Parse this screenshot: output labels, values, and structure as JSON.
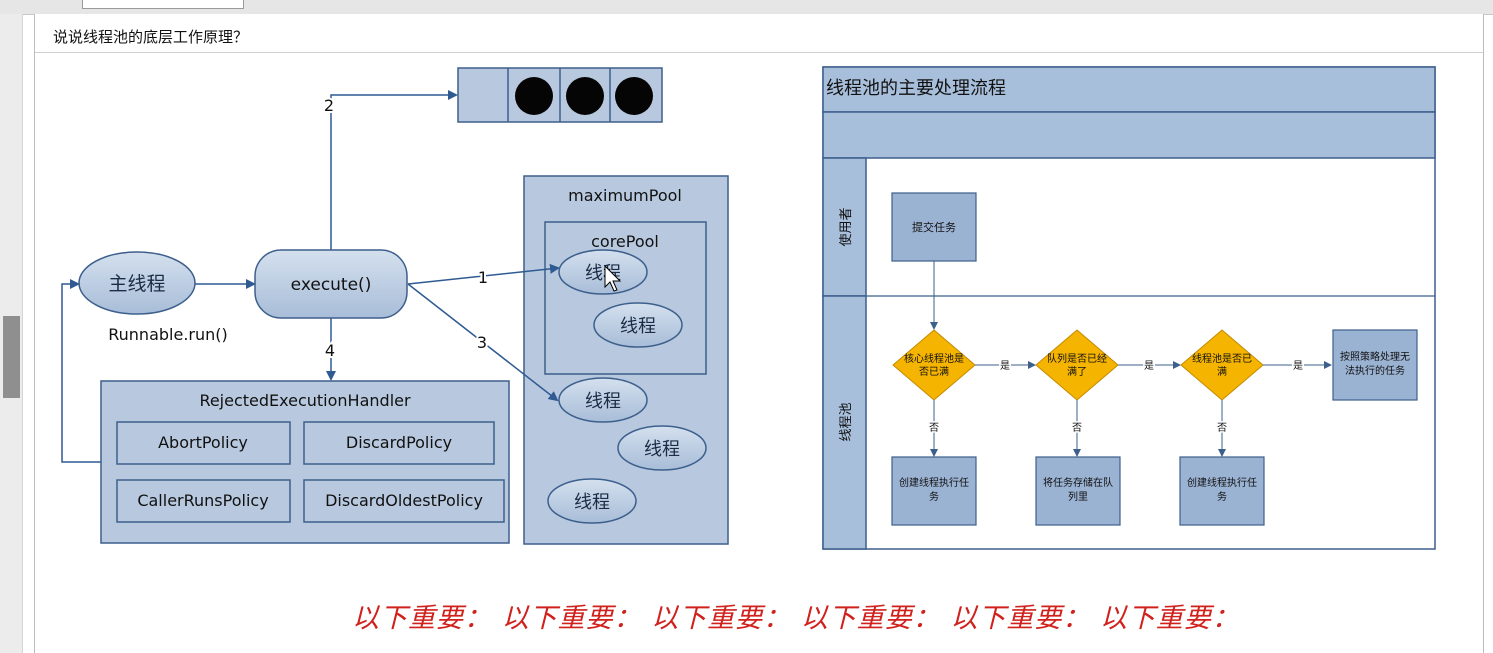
{
  "question": "说说线程池的底层工作原理？",
  "left_diagram": {
    "main_thread": "主线程",
    "runnable": "Runnable.run()",
    "execute": "execute()",
    "arrow_labels": {
      "one": "1",
      "two": "2",
      "three": "3",
      "four": "4"
    },
    "maximum_pool": "maximumPool",
    "core_pool": "corePool",
    "thread": "线程",
    "handler": "RejectedExecutionHandler",
    "policies": {
      "abort": "AbortPolicy",
      "discard": "DiscardPolicy",
      "caller_runs": "CallerRunsPolicy",
      "discard_oldest": "DiscardOldestPolicy"
    }
  },
  "flowchart": {
    "title": "线程池的主要处理流程",
    "lane_user": "使用者",
    "lane_pool": "线程池",
    "submit": "提交任务",
    "decision1": [
      "核心线程池是",
      "否已满"
    ],
    "decision2": [
      "队列是否已经",
      "满了"
    ],
    "decision3": [
      "线程池是否已",
      "满"
    ],
    "yes": "是",
    "no": "否",
    "result_reject": [
      "按照策略处理无",
      "法执行的任务"
    ],
    "result1": [
      "创建线程执行任",
      "务"
    ],
    "result2": [
      "将任务存储在队",
      "列里"
    ],
    "result3": [
      "创建线程执行任",
      "务"
    ]
  },
  "important_note": "以下重要： 以下重要： 以下重要： 以下重要： 以下重要： 以下重要：",
  "colors": {
    "box_fill": "#b8c9df",
    "box_stroke": "#3d5f8c",
    "arrow": "#2f5a92",
    "diamond": "#f5b400",
    "lane_header": "#a8bfdb",
    "flow_box": "#9bb3d3",
    "note": "#d0211c"
  }
}
